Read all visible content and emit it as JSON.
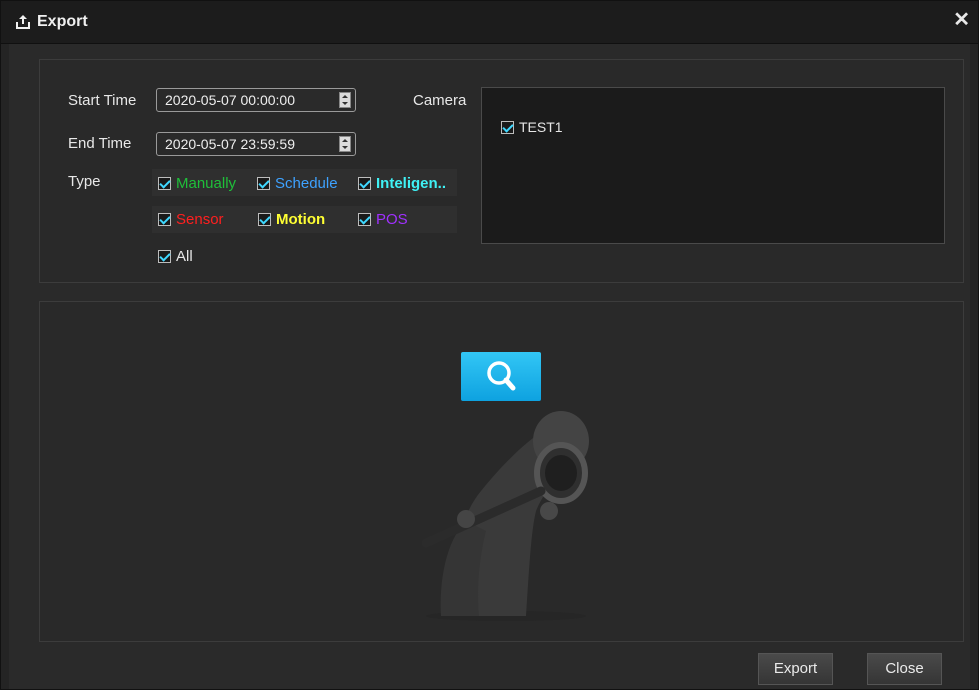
{
  "dialog": {
    "title": "Export",
    "title_icon": "export-icon",
    "close_glyph": "✕"
  },
  "filters": {
    "start_time_label": "Start Time",
    "start_time_value": "2020-05-07 00:00:00",
    "end_time_label": "End Time",
    "end_time_value": "2020-05-07 23:59:59",
    "type_label": "Type",
    "camera_label": "Camera",
    "types": [
      {
        "label": "Manually",
        "color": "#1fbf3a",
        "checked": true
      },
      {
        "label": "Schedule",
        "color": "#3ea2ff",
        "checked": true
      },
      {
        "label": "Inteligen..",
        "color": "#3ff1f5",
        "checked": true
      },
      {
        "label": "Sensor",
        "color": "#ff1f1f",
        "checked": true
      },
      {
        "label": "Motion",
        "color": "#ffff33",
        "checked": true
      },
      {
        "label": "POS",
        "color": "#a030ff",
        "checked": true
      },
      {
        "label": "All",
        "color": "#e6e6e6",
        "checked": true
      }
    ],
    "cameras": [
      {
        "label": "TEST1",
        "checked": true
      }
    ]
  },
  "results": {
    "search_icon": "search-icon",
    "empty_icon": "magnifier-figure-icon"
  },
  "footer": {
    "export_label": "Export",
    "close_label": "Close"
  },
  "colors": {
    "accent": "#1bb3ee",
    "checkmark": "#3fd8ff"
  }
}
